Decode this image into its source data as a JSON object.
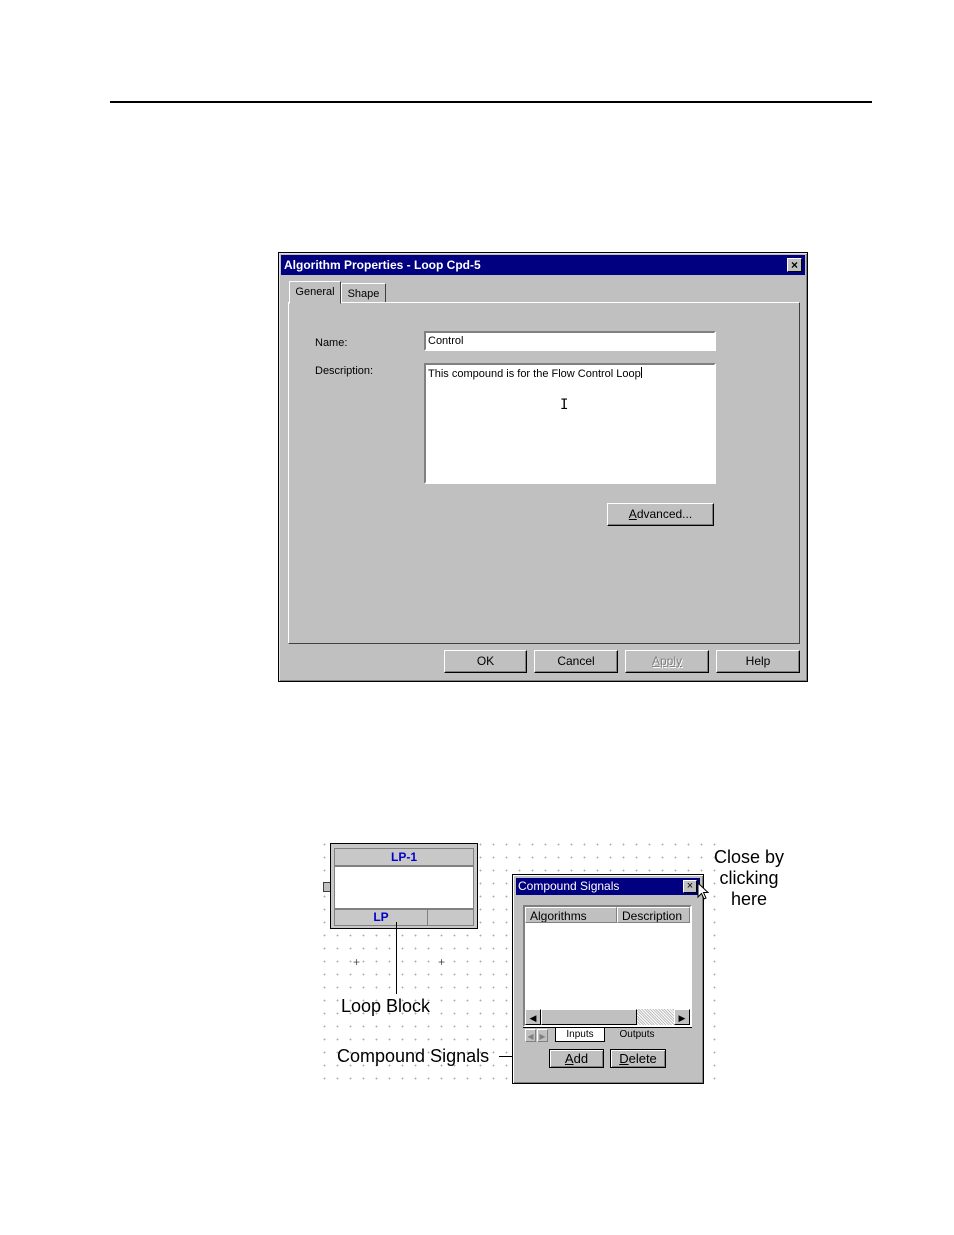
{
  "dialog": {
    "title": "Algorithm Properties - Loop Cpd-5",
    "close_glyph": "×",
    "tabs": [
      {
        "label": "General",
        "active": true
      },
      {
        "label": "Shape",
        "active": false
      }
    ],
    "name_label": "Name:",
    "name_value": "Control",
    "description_label": "Description:",
    "description_value": "This compound is for the Flow Control Loop",
    "advanced_button": {
      "underlined": "A",
      "rest": "dvanced..."
    },
    "buttons": {
      "ok": "OK",
      "cancel": "Cancel",
      "apply": "Apply",
      "help": "Help"
    },
    "apply_enabled": false
  },
  "loop_block": {
    "title": "LP-1",
    "type_label": "LP",
    "callout": "Loop Block"
  },
  "compound_signals": {
    "title": "Compound Signals",
    "close_glyph": "×",
    "columns": [
      "Algorithms",
      "Description"
    ],
    "rows": [],
    "tabs": [
      {
        "label": "Inputs",
        "active": true
      },
      {
        "label": "Outputs",
        "active": false
      }
    ],
    "add_button": {
      "underlined": "A",
      "rest": "dd"
    },
    "delete_button": {
      "underlined": "D",
      "rest": "elete"
    },
    "callout": "Compound Signals"
  },
  "close_callout": {
    "line1": "Close by",
    "line2": "clicking",
    "line3": "here"
  },
  "colors": {
    "titlebar": "#000080",
    "face": "#c0c0c0",
    "block_label": "#0000cc"
  }
}
